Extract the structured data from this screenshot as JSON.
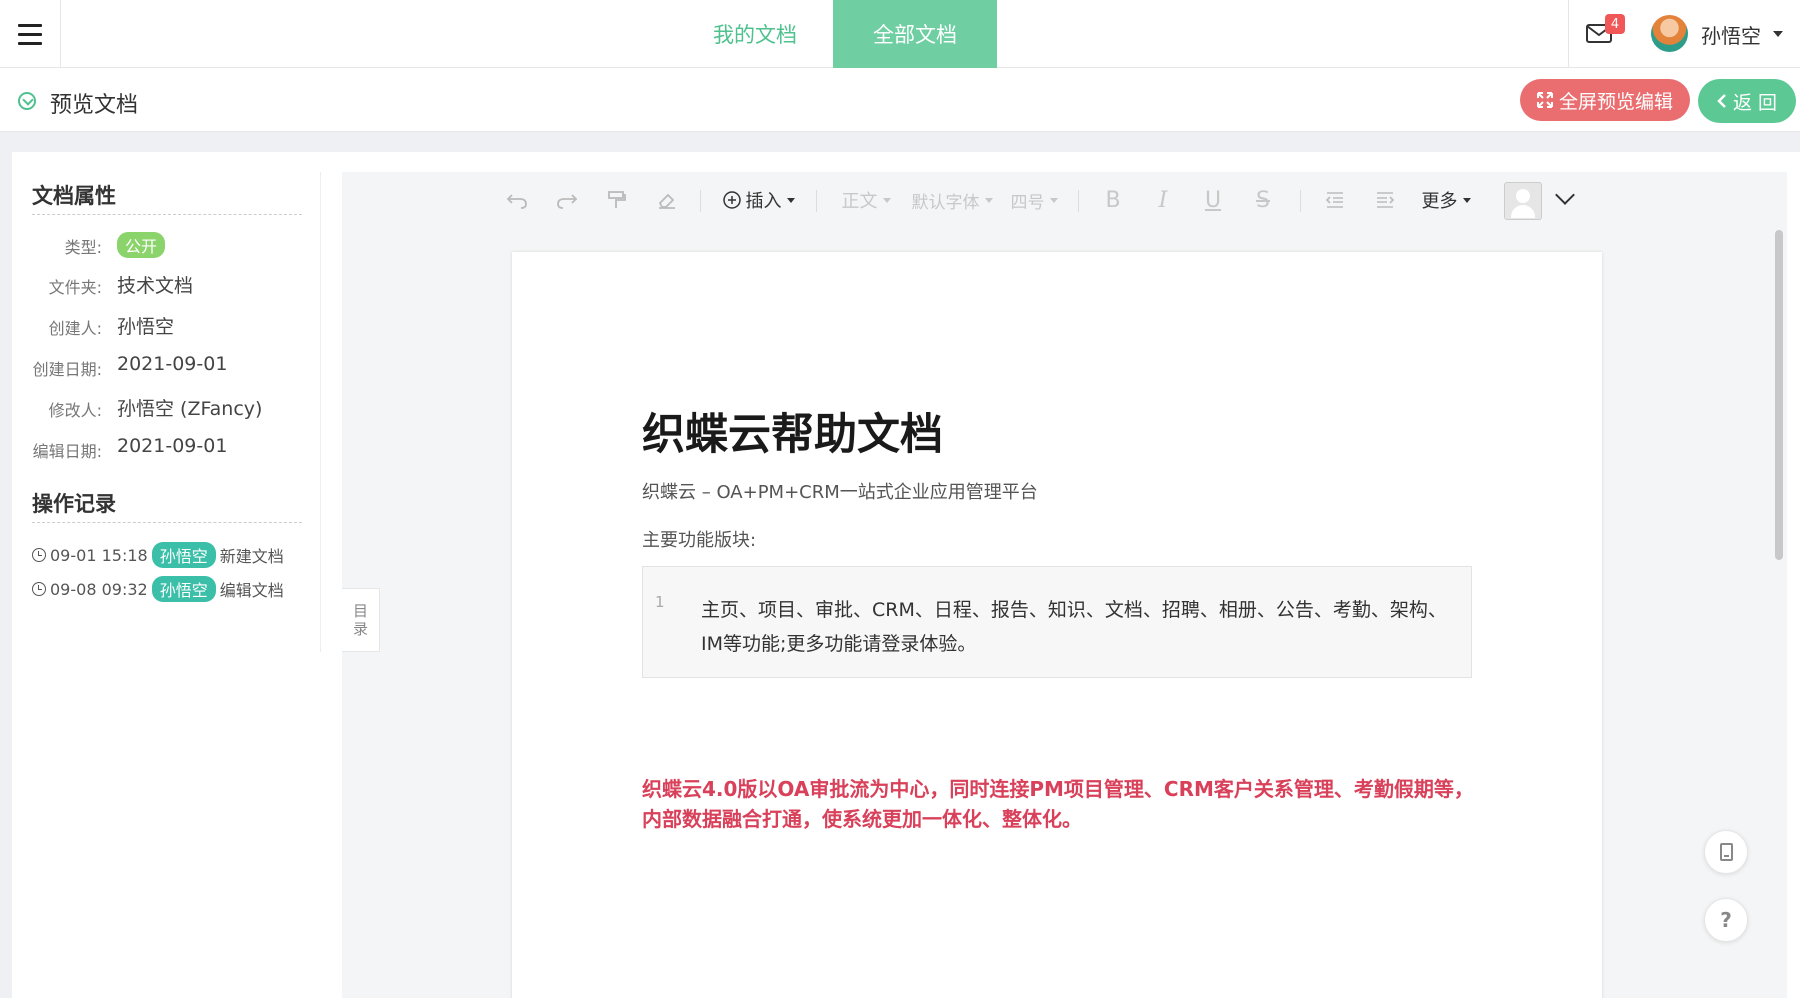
{
  "header": {
    "tabs": [
      {
        "label": "我的文档",
        "active": false
      },
      {
        "label": "全部文档",
        "active": true
      }
    ],
    "mail_count": "4",
    "user_name": "孙悟空"
  },
  "subheader": {
    "title": "预览文档",
    "fullscreen_label": "全屏预览编辑",
    "back_label": "返 回"
  },
  "properties": {
    "title": "文档属性",
    "rows": [
      {
        "label": "类型:",
        "value": "公开",
        "badge": true
      },
      {
        "label": "文件夹:",
        "value": "技术文档"
      },
      {
        "label": "创建人:",
        "value": "孙悟空"
      },
      {
        "label": "创建日期:",
        "value": "2021-09-01"
      },
      {
        "label": "修改人:",
        "value": "孙悟空 (ZFancy)"
      },
      {
        "label": "编辑日期:",
        "value": "2021-09-01"
      }
    ]
  },
  "log": {
    "title": "操作记录",
    "entries": [
      {
        "time": "09-01 15:18",
        "user": "孙悟空",
        "action": "新建文档"
      },
      {
        "time": "09-08 09:32",
        "user": "孙悟空",
        "action": "编辑文档"
      }
    ]
  },
  "toolbar": {
    "insert_label": "插入",
    "paragraph_label": "正文",
    "font_label": "默认字体",
    "size_label": "四号",
    "more_label": "更多",
    "bold": "B",
    "italic": "I",
    "underline": "U",
    "strike": "S"
  },
  "toc_label_1": "目",
  "toc_label_2": "录",
  "document": {
    "title": "织蝶云帮助文档",
    "subtitle": "织蝶云 – OA+PM+CRM一站式企业应用管理平台",
    "section_label": "主要功能版块:",
    "code_line_no": "1",
    "code_text": "主页、项目、审批、CRM、日程、报告、知识、文档、招聘、相册、公告、考勤、架构、IM等功能;更多功能请登录体验。",
    "highlight": "织蝶云4.0版以OA审批流为中心，同时连接PM项目管理、CRM客户关系管理、考勤假期等，内部数据融合打通，使系统更加一体化、整体化。"
  },
  "help_label": "?",
  "colors": {
    "accent_green": "#4fc18f",
    "tab_active_bg": "#6fcfa3",
    "fullscreen_btn": "#ea6e70",
    "back_btn": "#5cc995",
    "highlight_red": "#d9405a"
  }
}
